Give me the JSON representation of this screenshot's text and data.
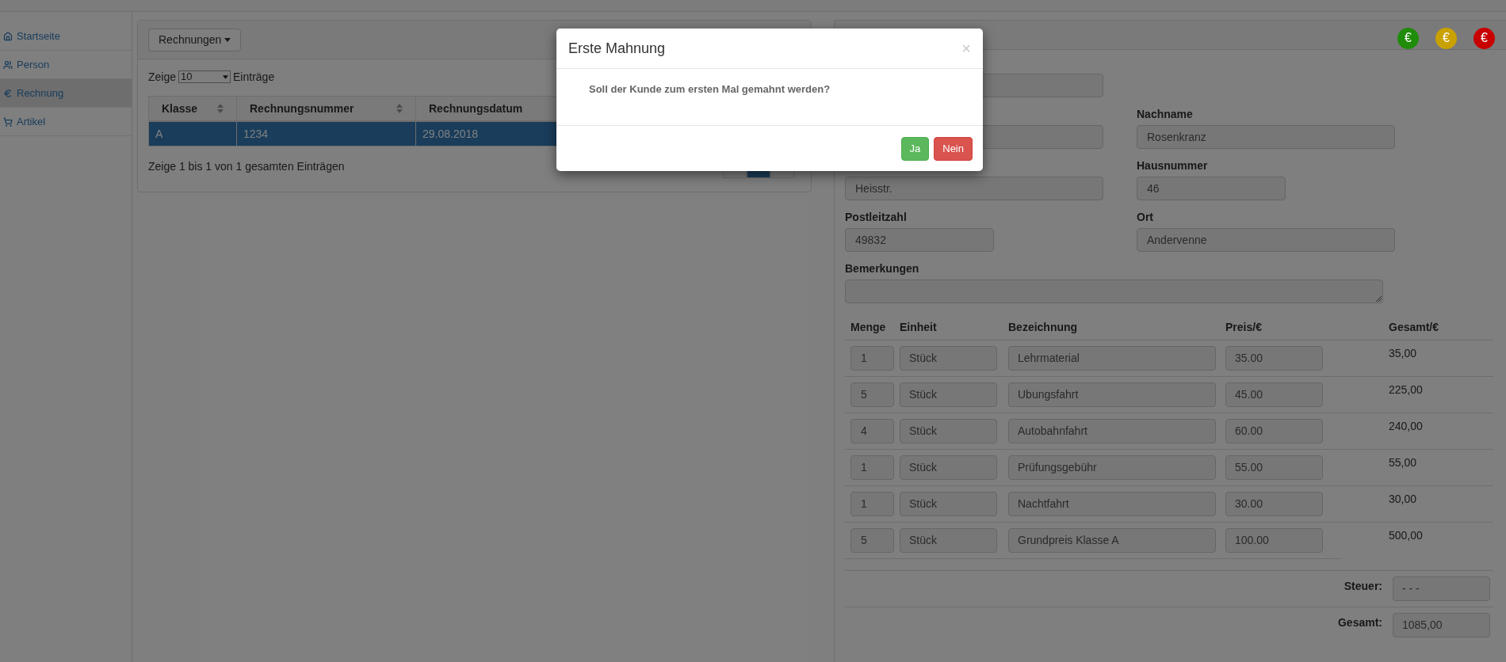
{
  "sidebar": {
    "items": [
      {
        "label": "Startseite",
        "selected": false
      },
      {
        "label": "Person",
        "selected": false
      },
      {
        "label": "Rechnung",
        "selected": true
      },
      {
        "label": "Artikel",
        "selected": false
      }
    ]
  },
  "invoices_panel": {
    "dropdown": "Rechnungen",
    "length_prefix": "Zeige",
    "length_value": "10",
    "length_suffix": "Einträge",
    "columns": [
      {
        "label": "Klasse",
        "sort_icon": true
      },
      {
        "label": "Rechnungsnummer",
        "sort_icon": true
      },
      {
        "label": "Rechnungsdatum"
      }
    ],
    "rows": [
      {
        "cells": [
          "A",
          "1234",
          "29.08.2018"
        ],
        "selected": true
      }
    ],
    "info": "Zeige 1 bis 1 von 1 gesamten Einträgen",
    "pagination": [
      {
        "selected": false
      },
      {
        "selected": true
      },
      {
        "selected": false
      }
    ]
  },
  "detail_panel": {
    "status_buttons": [
      {
        "symbol": "€",
        "color": "#1f8c0a"
      },
      {
        "symbol": "€",
        "color": "#c9a100"
      },
      {
        "symbol": "€",
        "color": "#c80000"
      }
    ],
    "field_rows": [
      [
        {}
      ],
      [
        {},
        {
          "label": "Nachname",
          "value": "Rosenkranz"
        }
      ],
      [
        {
          "value": "Heisstr."
        },
        {
          "label": "Hausnummer",
          "value": "46"
        }
      ],
      [
        {
          "label": "Postleitzahl",
          "value": "49832"
        },
        {
          "label": "Ort",
          "value": "Andervenne"
        }
      ]
    ],
    "remarks_label": "Bemerkungen",
    "items_columns": [
      "Menge",
      "Einheit",
      "Bezeichnung",
      "Preis/€",
      "Gesamt/€"
    ],
    "items": [
      {
        "qty": "1",
        "unit": "Stück",
        "name": "Lehrmaterial",
        "price": "35.00",
        "total": "35,00"
      },
      {
        "qty": "5",
        "unit": "Stück",
        "name": "Ubungsfahrt",
        "price": "45.00",
        "total": "225,00"
      },
      {
        "qty": "4",
        "unit": "Stück",
        "name": "Autobahnfahrt",
        "price": "60.00",
        "total": "240,00"
      },
      {
        "qty": "1",
        "unit": "Stück",
        "name": "Prüfungsgebühr",
        "price": "55.00",
        "total": "55,00"
      },
      {
        "qty": "1",
        "unit": "Stück",
        "name": "Nachtfahrt",
        "price": "30.00",
        "total": "30,00"
      },
      {
        "qty": "5",
        "unit": "Stück",
        "name": "Grundpreis Klasse A",
        "price": "100.00",
        "total": "500,00"
      }
    ],
    "summary": [
      {
        "label": "Steuer:",
        "value": "- - -"
      },
      {
        "label": "Gesamt:",
        "value": "1085,00"
      }
    ]
  },
  "modal": {
    "title": "Erste Mahnung",
    "close": "×",
    "message": "Soll der Kunde zum ersten Mal gemahnt werden?",
    "buttons": [
      {
        "kind": "confirm",
        "label": "Ja"
      },
      {
        "kind": "cancel",
        "label": "Nein"
      }
    ]
  }
}
